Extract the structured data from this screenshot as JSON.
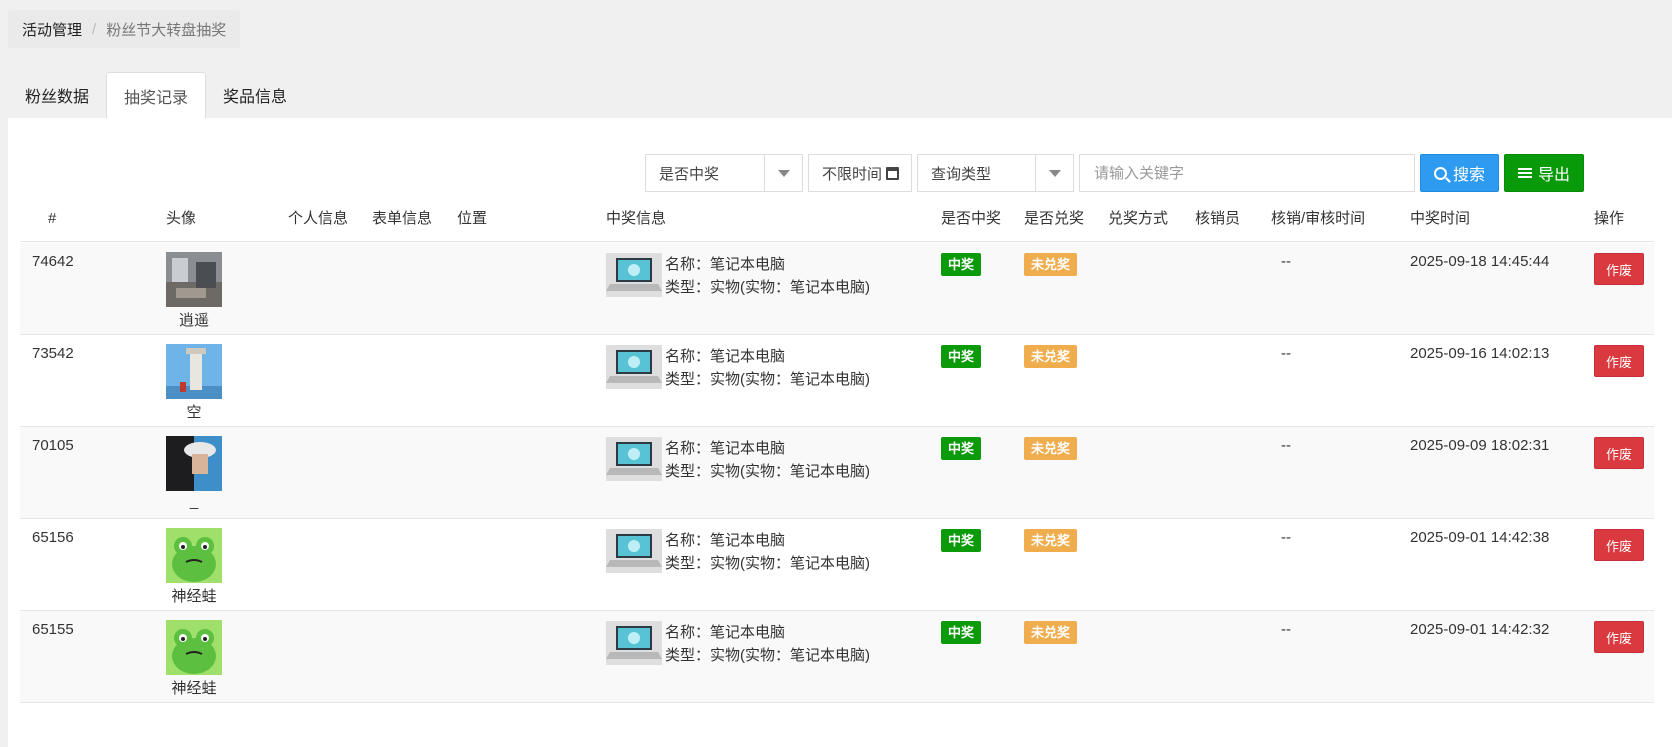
{
  "breadcrumb": {
    "parent": "活动管理",
    "separator": "/",
    "current": "粉丝节大转盘抽奖"
  },
  "tabs": [
    {
      "label": "粉丝数据"
    },
    {
      "label": "抽奖记录"
    },
    {
      "label": "奖品信息"
    }
  ],
  "filters": {
    "win_select": "是否中奖",
    "date_label": "不限时间",
    "query_type": "查询类型",
    "keyword_placeholder": "请输入关键字",
    "search_label": "搜索",
    "export_label": "导出"
  },
  "columns": {
    "id": "#",
    "avatar": "头像",
    "personal": "个人信息",
    "form": "表单信息",
    "location": "位置",
    "prize": "中奖信息",
    "won": "是否中奖",
    "redeemed": "是否兑奖",
    "method": "兑奖方式",
    "verifier": "核销员",
    "audit_time": "核销/审核时间",
    "won_time": "中奖时间",
    "action": "操作"
  },
  "rows": [
    {
      "id": "74642",
      "nickname": "逍遥",
      "prize_name": "名称：笔记本电脑",
      "prize_type": "类型：实物(实物：笔记本电脑)",
      "won": "中奖",
      "redeemed": "未兑奖",
      "audit_time": "--",
      "won_time": "2025-09-18 14:45:44",
      "action": "作废"
    },
    {
      "id": "73542",
      "nickname": "空",
      "prize_name": "名称：笔记本电脑",
      "prize_type": "类型：实物(实物：笔记本电脑)",
      "won": "中奖",
      "redeemed": "未兑奖",
      "audit_time": "--",
      "won_time": "2025-09-16 14:02:13",
      "action": "作废"
    },
    {
      "id": "70105",
      "nickname": "_",
      "prize_name": "名称：笔记本电脑",
      "prize_type": "类型：实物(实物：笔记本电脑)",
      "won": "中奖",
      "redeemed": "未兑奖",
      "audit_time": "--",
      "won_time": "2025-09-09 18:02:31",
      "action": "作废"
    },
    {
      "id": "65156",
      "nickname": "神经蛙",
      "prize_name": "名称：笔记本电脑",
      "prize_type": "类型：实物(实物：笔记本电脑)",
      "won": "中奖",
      "redeemed": "未兑奖",
      "audit_time": "--",
      "won_time": "2025-09-01 14:42:38",
      "action": "作废"
    },
    {
      "id": "65155",
      "nickname": "神经蛙",
      "prize_name": "名称：笔记本电脑",
      "prize_type": "类型：实物(实物：笔记本电脑)",
      "won": "中奖",
      "redeemed": "未兑奖",
      "audit_time": "--",
      "won_time": "2025-09-01 14:42:32",
      "action": "作废"
    }
  ]
}
